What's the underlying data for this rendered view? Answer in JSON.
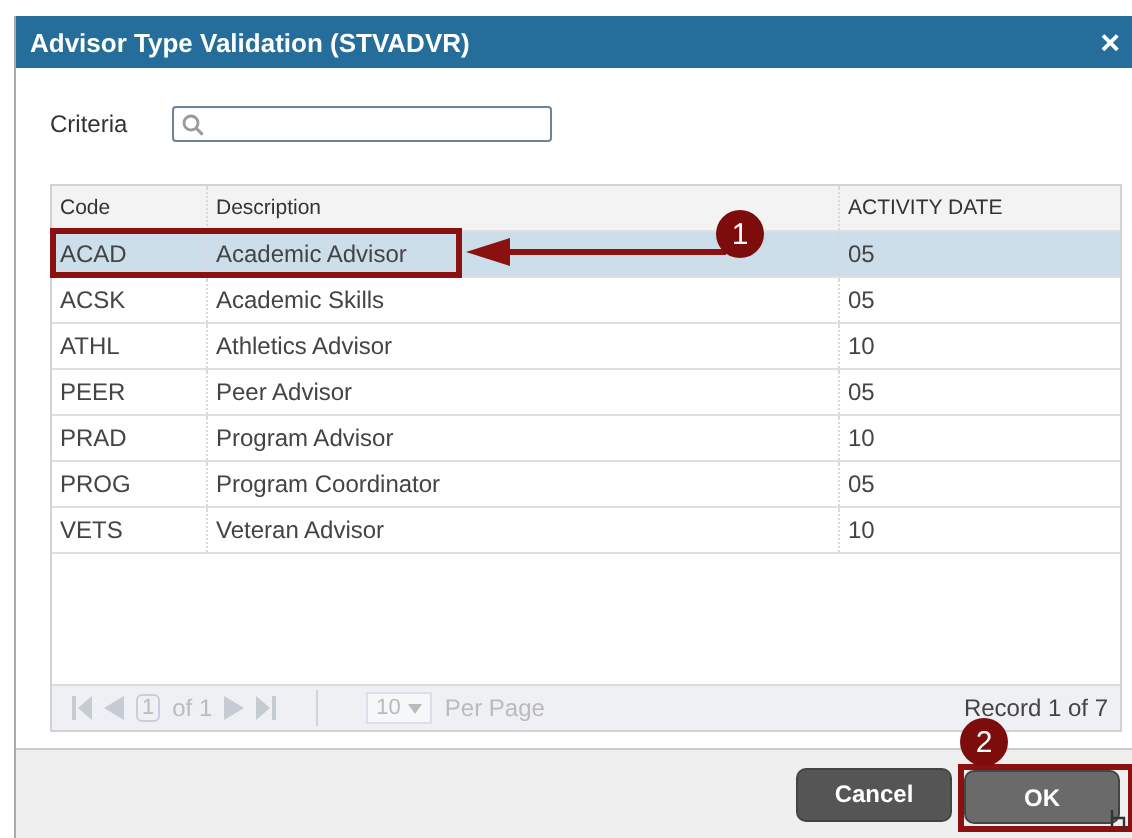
{
  "window": {
    "title": "Advisor Type Validation (STVADVR)",
    "close": "×"
  },
  "criteria": {
    "label": "Criteria"
  },
  "table": {
    "columns": [
      "Code",
      "Description",
      "ACTIVITY DATE"
    ],
    "rows": [
      {
        "cells": [
          "ACAD",
          "Academic Advisor",
          "05"
        ],
        "selected": true
      },
      {
        "cells": [
          "ACSK",
          "Academic Skills",
          "05"
        ],
        "selected": false
      },
      {
        "cells": [
          "ATHL",
          "Athletics Advisor",
          "10"
        ],
        "selected": false
      },
      {
        "cells": [
          "PEER",
          "Peer Advisor",
          "05"
        ],
        "selected": false
      },
      {
        "cells": [
          "PRAD",
          "Program Advisor",
          "10"
        ],
        "selected": false
      },
      {
        "cells": [
          "PROG",
          "Program Coordinator",
          "05"
        ],
        "selected": false
      },
      {
        "cells": [
          "VETS",
          "Veteran Advisor",
          "10"
        ],
        "selected": false
      }
    ]
  },
  "pager": {
    "page": "1",
    "of": "of 1",
    "per_page_value": "10",
    "per_page_label": "Per Page",
    "record": "Record 1 of 7"
  },
  "buttons": [
    {
      "label": "Cancel",
      "kind": "secondary"
    },
    {
      "label": "OK",
      "kind": "primary"
    }
  ],
  "callouts": [
    {
      "number": "1"
    },
    {
      "number": "2"
    }
  ]
}
